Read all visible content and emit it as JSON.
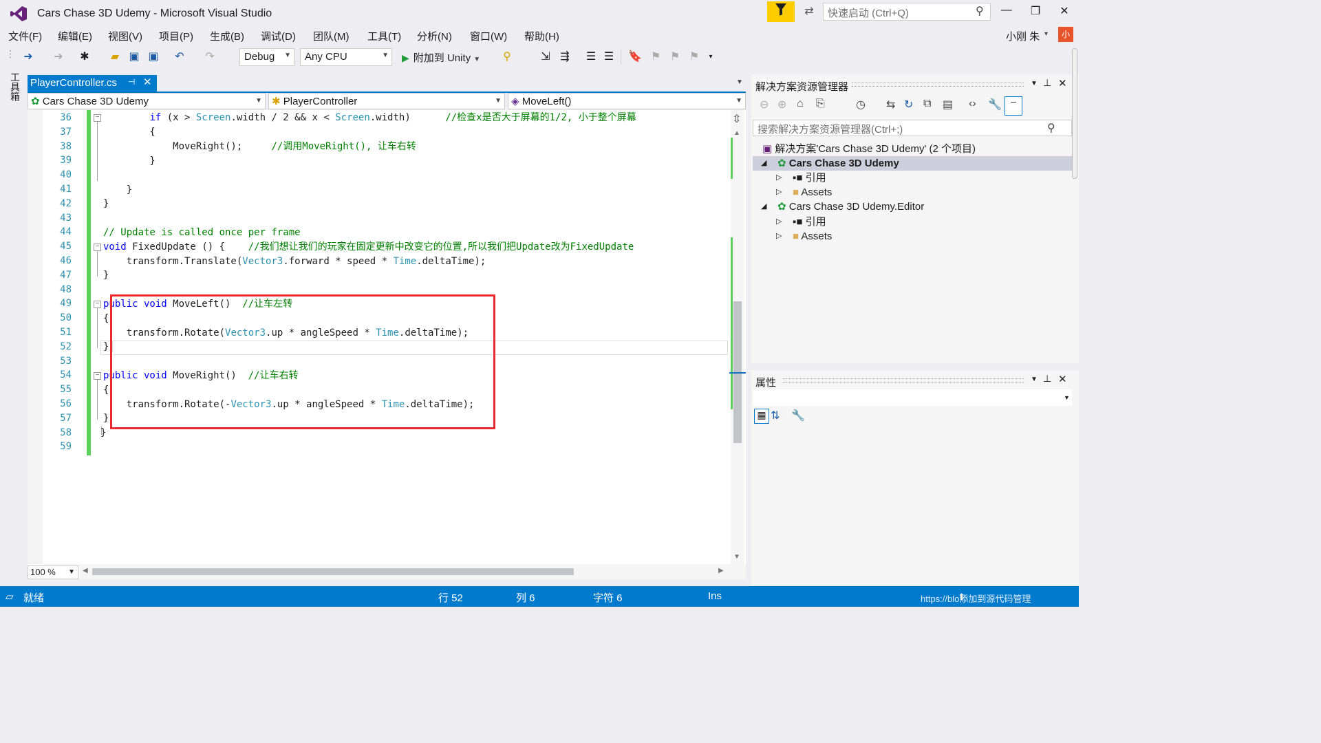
{
  "window": {
    "title": "Cars Chase 3D Udemy - Microsoft Visual Studio",
    "quick_launch_placeholder": "快速启动 (Ctrl+Q)"
  },
  "menu": [
    "文件(F)",
    "编辑(E)",
    "视图(V)",
    "项目(P)",
    "生成(B)",
    "调试(D)",
    "团队(M)",
    "工具(T)",
    "分析(N)",
    "窗口(W)",
    "帮助(H)"
  ],
  "user": {
    "name": "小刚 朱",
    "avatar": "小"
  },
  "toolbar": {
    "config": "Debug",
    "platform": "Any CPU",
    "run_label": "附加到 Unity"
  },
  "toolbox_label": "工具箱",
  "tab": {
    "label": "PlayerController.cs"
  },
  "navbar": {
    "project": "Cars Chase 3D Udemy",
    "class": "PlayerController",
    "member": "MoveLeft()"
  },
  "code": {
    "line_numbers": [
      "36",
      "37",
      "38",
      "39",
      "40",
      "41",
      "42",
      "43",
      "44",
      "45",
      "46",
      "47",
      "48",
      "49",
      "50",
      "51",
      "52",
      "53",
      "54",
      "55",
      "56",
      "57",
      "58",
      "59"
    ]
  },
  "zoom": "100 %",
  "solution_explorer": {
    "title": "解决方案资源管理器",
    "search_placeholder": "搜索解决方案资源管理器(Ctrl+;)",
    "solution": "解决方案'Cars Chase 3D Udemy' (2 个项目)",
    "project1": "Cars Chase 3D Udemy",
    "references": "引用",
    "assets": "Assets",
    "project2": "Cars Chase 3D Udemy.Editor"
  },
  "properties": {
    "title": "属性"
  },
  "status": {
    "ready": "就绪",
    "line": "行 52",
    "col": "列 6",
    "char": "字符 6",
    "mode": "Ins",
    "right": "https://blo添加到源代码管理"
  },
  "colors": {
    "accent": "#007acc",
    "highlight_box": "#e8292f",
    "change_bar": "#5bd25b",
    "keyword": "#0000ff",
    "type": "#2b91af",
    "comment": "#008000"
  }
}
